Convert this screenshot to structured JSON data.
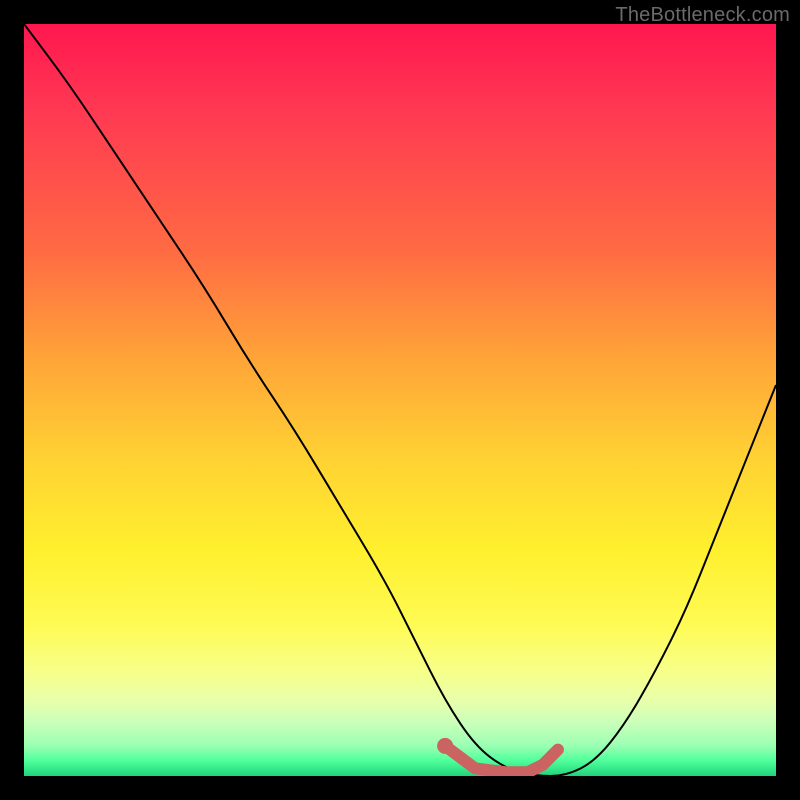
{
  "watermark": "TheBottleneck.com",
  "chart_data": {
    "type": "line",
    "title": "",
    "xlabel": "",
    "ylabel": "",
    "xlim": [
      0,
      100
    ],
    "ylim": [
      0,
      100
    ],
    "grid": false,
    "legend": false,
    "series": [
      {
        "name": "bottleneck-curve",
        "x": [
          0,
          6,
          12,
          18,
          24,
          30,
          36,
          42,
          48,
          52,
          56,
          60,
          64,
          68,
          72,
          76,
          80,
          84,
          88,
          92,
          96,
          100
        ],
        "y": [
          100,
          92,
          83,
          74,
          65,
          55,
          46,
          36,
          26,
          18,
          10,
          4,
          1,
          0,
          0,
          2,
          7,
          14,
          22,
          32,
          42,
          52
        ]
      }
    ],
    "highlight": {
      "name": "flat-valley-marker",
      "x": [
        56,
        60,
        64,
        67,
        69,
        71
      ],
      "y": [
        4,
        1,
        0.5,
        0.5,
        1.5,
        3.5
      ]
    },
    "highlight_dot": {
      "x": 56,
      "y": 4
    },
    "colors": {
      "curve": "#000000",
      "highlight": "#cb6362",
      "gradient_top": "#ff1750",
      "gradient_bottom": "#1fd27a"
    }
  }
}
